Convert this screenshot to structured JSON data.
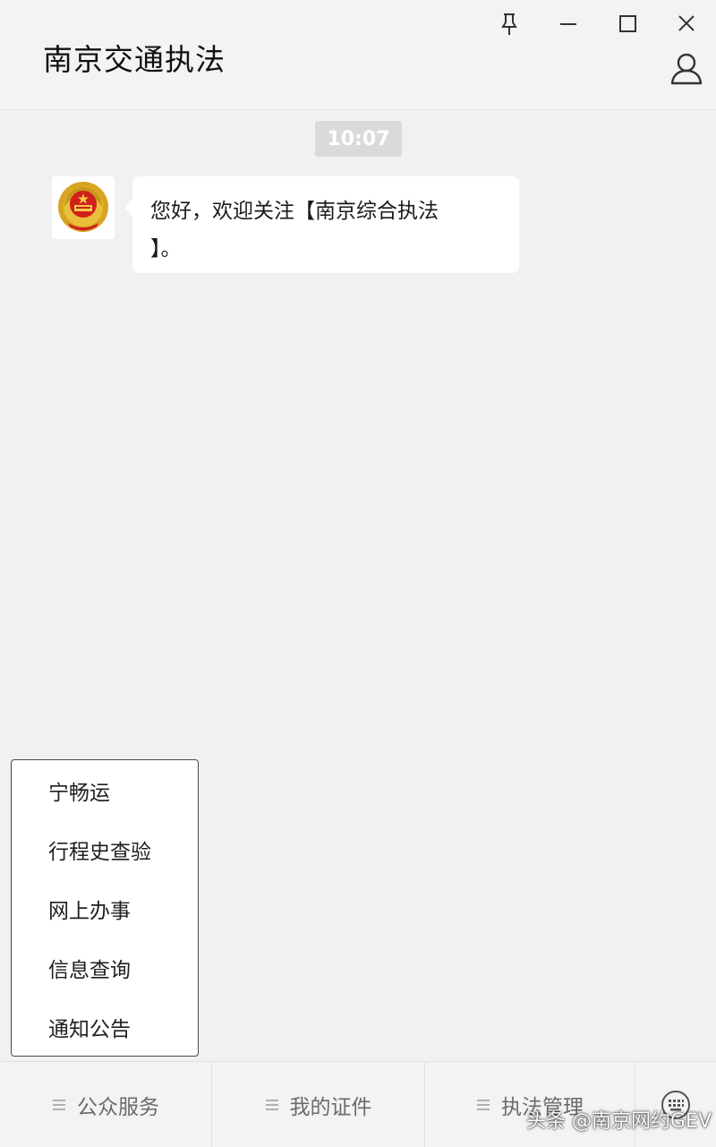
{
  "header": {
    "title": "南京交通执法",
    "icons": [
      "pin-icon",
      "minimize-icon",
      "maximize-icon",
      "close-icon",
      "user-profile-icon"
    ]
  },
  "chat": {
    "timestamp": "10:07",
    "message": {
      "line1": "您好，欢迎关注【南京综合执法",
      "line2": "】。"
    }
  },
  "menu_popup": {
    "items": [
      "宁畅运",
      "行程史查验",
      "网上办事",
      "信息查询",
      "通知公告"
    ]
  },
  "bottom_menu": {
    "tabs": [
      "公众服务",
      "我的证件",
      "执法管理"
    ],
    "keyboard_icon": "keyboard-icon"
  },
  "watermark": "头条 @南京网约GEV",
  "colors": {
    "background": "#f1f1f3",
    "bubble": "#ffffff",
    "timestamp_bg": "#dadadc",
    "emblem_gold": "#d9a422",
    "emblem_red": "#d0201c"
  }
}
